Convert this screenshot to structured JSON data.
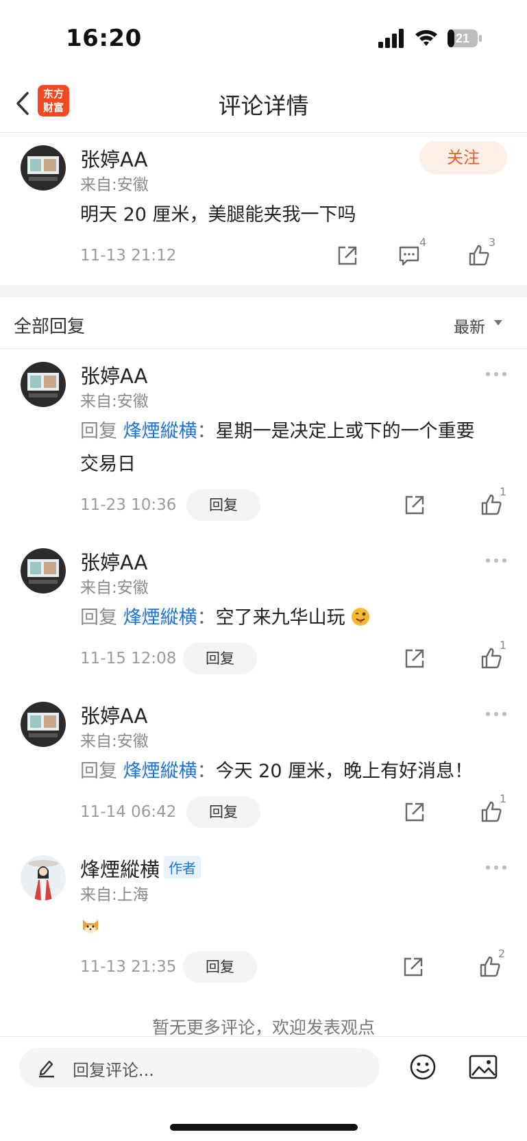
{
  "status": {
    "time": "16:20",
    "battery": "21"
  },
  "nav": {
    "title": "评论详情",
    "logo": [
      "东方",
      "财富"
    ]
  },
  "main_comment": {
    "user": "张婷AA",
    "location": "来自:安徽",
    "follow_label": "关注",
    "text": "明天 20 厘米，美腿能夹我一下吗",
    "time": "11-13 21:12",
    "comment_count": "4",
    "like_count": "3"
  },
  "replies_header": {
    "title": "全部回复",
    "sort": "最新"
  },
  "replies": [
    {
      "user": "张婷AA",
      "location": "来自:安徽",
      "prefix": "回复",
      "mention": "烽煙縱横",
      "colon": "：",
      "text": "星期一是决定上或下的一个重要",
      "text2": "交易日",
      "time": "11-23 10:36",
      "reply_label": "回复",
      "likes": "1"
    },
    {
      "user": "张婷AA",
      "location": "来自:安徽",
      "prefix": "回复",
      "mention": "烽煙縱横",
      "colon": "：",
      "text": "空了来九华山玩",
      "emoji": "winking-tongue-emoji",
      "time": "11-15 12:08",
      "reply_label": "回复",
      "likes": "1"
    },
    {
      "user": "张婷AA",
      "location": "来自:安徽",
      "prefix": "回复",
      "mention": "烽煙縱横",
      "colon": "：",
      "text": "今天 20 厘米，晚上有好消息！",
      "time": "11-14 06:42",
      "reply_label": "回复",
      "likes": "1"
    },
    {
      "user": "烽煙縱横",
      "badge": "作者",
      "location": "来自:上海",
      "emoji": "cat-emoji",
      "time": "11-13 21:35",
      "reply_label": "回复",
      "likes": "2"
    }
  ],
  "footer": {
    "note": "暂无更多评论，欢迎发表观点"
  },
  "bottom_bar": {
    "placeholder": "回复评论..."
  },
  "colors": {
    "accent": "#ef4a21",
    "mention": "#1a73d9",
    "follow_bg": "#fdeee8"
  }
}
